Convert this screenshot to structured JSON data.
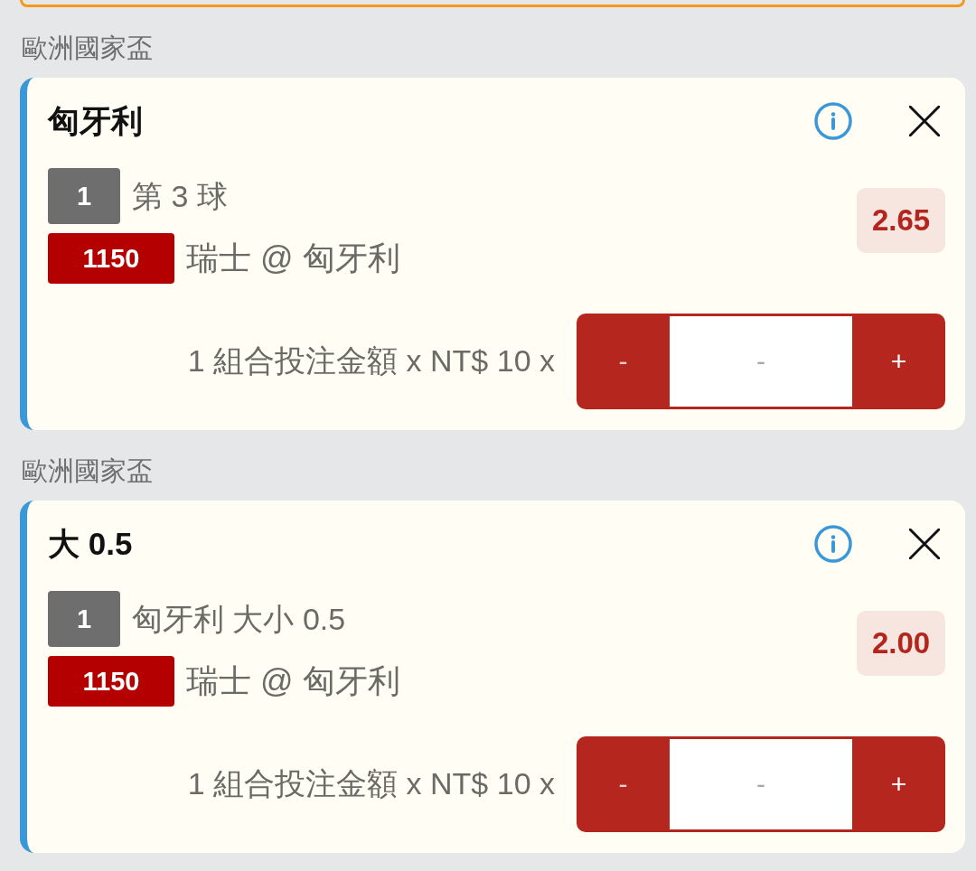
{
  "bets": [
    {
      "league": "歐洲國家盃",
      "selection": "匈牙利",
      "market_code": "1",
      "market": "第 3 球",
      "match_code": "1150",
      "match": "瑞士 @ 匈牙利",
      "odds": "2.65",
      "stake_label": "1 組合投注金額 x NT$ 10 x",
      "stepper": {
        "minus": "-",
        "placeholder": "-",
        "plus": "+"
      }
    },
    {
      "league": "歐洲國家盃",
      "selection": "大 0.5",
      "market_code": "1",
      "market": "匈牙利 大小 0.5",
      "match_code": "1150",
      "match": "瑞士 @ 匈牙利",
      "odds": "2.00",
      "stake_label": "1 組合投注金額 x NT$ 10 x",
      "stepper": {
        "minus": "-",
        "placeholder": "-",
        "plus": "+"
      }
    }
  ]
}
